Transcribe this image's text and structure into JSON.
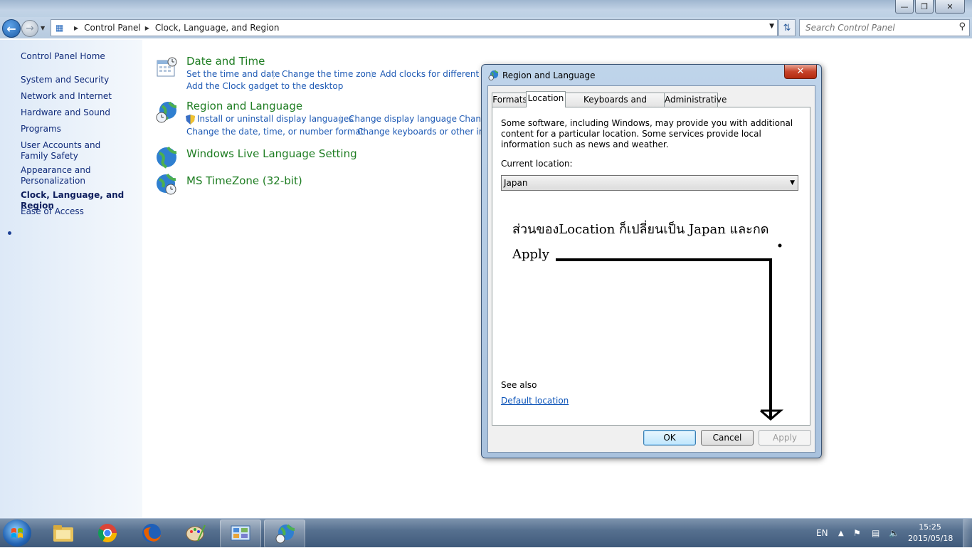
{
  "window": {
    "minimize_icon": "minimize-icon",
    "maximize_icon": "restore-icon",
    "close_icon": "close-icon"
  },
  "navbar": {
    "breadcrumb": [
      "Control Panel",
      "Clock, Language, and Region"
    ],
    "search_placeholder": "Search Control Panel"
  },
  "sidebar": {
    "home": "Control Panel Home",
    "items": [
      "System and Security",
      "Network and Internet",
      "Hardware and Sound",
      "Programs",
      "User Accounts and Family Safety",
      "Appearance and Personalization",
      "Clock, Language, and Region",
      "Ease of Access"
    ]
  },
  "main": {
    "date_time": {
      "title": "Date and Time",
      "tasks": [
        "Set the time and date",
        "Change the time zone",
        "Add clocks for different tim",
        "Add the Clock gadget to the desktop"
      ]
    },
    "region_language": {
      "title": "Region and Language",
      "tasks": [
        "Install or uninstall display languages",
        "Change display language",
        "Chang",
        "Change the date, time, or number format",
        "Change keyboards or other input"
      ]
    },
    "live_language": {
      "title": "Windows Live Language Setting"
    },
    "timezone": {
      "title": "MS TimeZone (32-bit)"
    }
  },
  "dialog": {
    "title": "Region and Language",
    "tabs": [
      "Formats",
      "Location",
      "Keyboards and Languages",
      "Administrative"
    ],
    "description": "Some software, including Windows, may provide you with additional content for a particular location. Some services provide local information such as news and weather.",
    "current_location_label": "Current location:",
    "current_location_value": "Japan",
    "annotation_line1": "ส่วนของLocation ก็เปลี่ยนเป็น Japan และกด",
    "annotation_line2": "Apply",
    "see_also": "See also",
    "default_location_link": "Default location",
    "buttons": {
      "ok": "OK",
      "cancel": "Cancel",
      "apply": "Apply"
    }
  },
  "taskbar": {
    "apps": [
      "file-explorer-icon",
      "chrome-icon",
      "firefox-icon",
      "paint-icon",
      "control-panel-icon",
      "region-language-icon"
    ],
    "language": "EN",
    "time": "15:25",
    "date": "2015/05/18"
  }
}
